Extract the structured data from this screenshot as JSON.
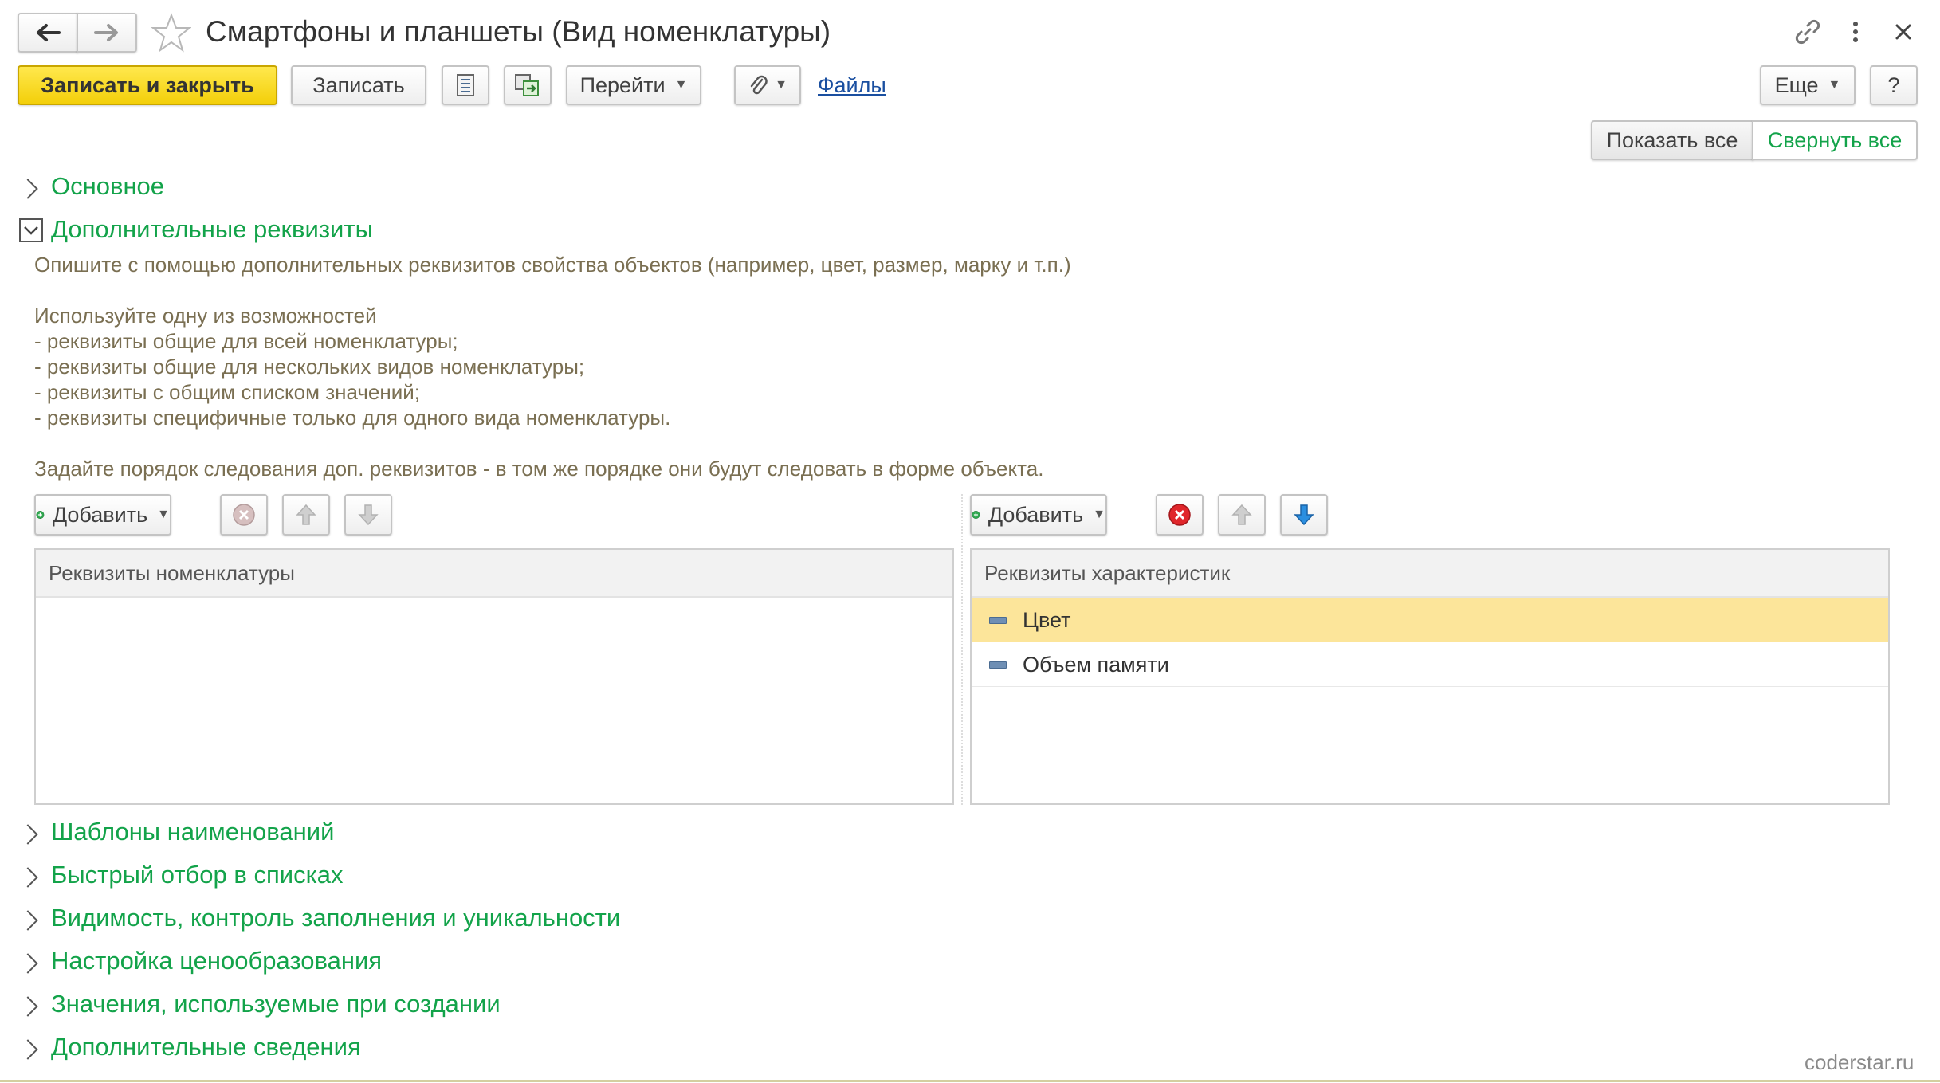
{
  "window": {
    "title": "Смартфоны и планшеты (Вид номенклатуры)"
  },
  "toolbar": {
    "save_close": "Записать и закрыть",
    "save": "Записать",
    "goto": "Перейти",
    "files": "Файлы",
    "more": "Еще",
    "help": "?"
  },
  "view_buttons": {
    "show_all": "Показать все",
    "collapse_all": "Свернуть все"
  },
  "sections": {
    "main": "Основное",
    "additional_attrs": "Дополнительные реквизиты",
    "name_templates": "Шаблоны наименований",
    "quick_filter": "Быстрый отбор в списках",
    "visibility": "Видимость, контроль заполнения и уникальности",
    "pricing": "Настройка ценообразования",
    "defaults": "Значения, используемые при создании",
    "extra_info": "Дополнительные сведения"
  },
  "description": {
    "line1": "Опишите с помощью дополнительных реквизитов свойства объектов (например, цвет, размер, марку и т.п.)",
    "line2": "Используйте одну из возможностей",
    "line3": "- реквизиты общие для всей номенклатуры;",
    "line4": "- реквизиты общие для нескольких видов номенклатуры;",
    "line5": "- реквизиты с общим списком значений;",
    "line6": "- реквизиты специфичные только для одного вида номенклатуры.",
    "line7": "Задайте порядок следования доп. реквизитов - в том же порядке они будут следовать в форме объекта."
  },
  "left_table": {
    "add": "Добавить",
    "header": "Реквизиты номенклатуры",
    "rows": []
  },
  "right_table": {
    "add": "Добавить",
    "header": "Реквизиты характеристик",
    "rows": [
      "Цвет",
      "Объем памяти"
    ]
  },
  "watermark": "coderstar.ru",
  "colors": {
    "accent_green": "#13a34a",
    "primary_yellow": "#f3cf0a",
    "selected_row": "#fce59a",
    "description_text": "#7a6f52"
  }
}
